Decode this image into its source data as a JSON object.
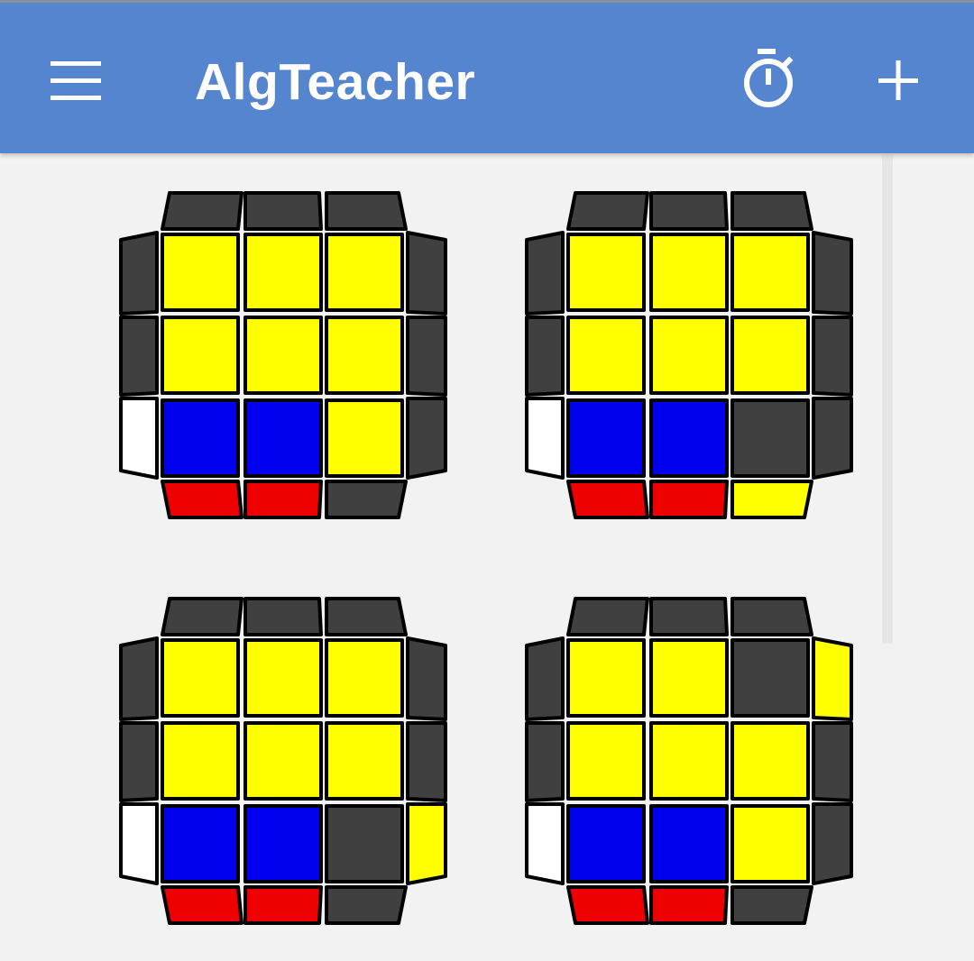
{
  "app": {
    "title": "AlgTeacher",
    "icons": {
      "menu": "hamburger-menu-icon",
      "timer": "stopwatch-icon",
      "add": "plus-icon"
    }
  },
  "colors": {
    "appbar": "#5585cf",
    "background": "#f2f2f2",
    "Y": "#ffff00",
    "B": "#0000ee",
    "R": "#ee0000",
    "W": "#ffffff",
    "G": "#404040"
  },
  "cases": [
    {
      "top": [
        "G",
        "G",
        "G"
      ],
      "left": [
        "G",
        "G",
        "W"
      ],
      "right": [
        "G",
        "G",
        "G"
      ],
      "bottom": [
        "R",
        "R",
        "G"
      ],
      "face": [
        [
          "Y",
          "Y",
          "Y"
        ],
        [
          "Y",
          "Y",
          "Y"
        ],
        [
          "B",
          "B",
          "Y"
        ]
      ]
    },
    {
      "top": [
        "G",
        "G",
        "G"
      ],
      "left": [
        "G",
        "G",
        "W"
      ],
      "right": [
        "G",
        "G",
        "G"
      ],
      "bottom": [
        "R",
        "R",
        "Y"
      ],
      "face": [
        [
          "Y",
          "Y",
          "Y"
        ],
        [
          "Y",
          "Y",
          "Y"
        ],
        [
          "B",
          "B",
          "G"
        ]
      ]
    },
    {
      "top": [
        "G",
        "G",
        "G"
      ],
      "left": [
        "G",
        "G",
        "W"
      ],
      "right": [
        "G",
        "G",
        "Y"
      ],
      "bottom": [
        "R",
        "R",
        "G"
      ],
      "face": [
        [
          "Y",
          "Y",
          "Y"
        ],
        [
          "Y",
          "Y",
          "Y"
        ],
        [
          "B",
          "B",
          "G"
        ]
      ]
    },
    {
      "top": [
        "G",
        "G",
        "G"
      ],
      "left": [
        "G",
        "G",
        "W"
      ],
      "right": [
        "Y",
        "G",
        "G"
      ],
      "bottom": [
        "R",
        "R",
        "G"
      ],
      "face": [
        [
          "Y",
          "Y",
          "G"
        ],
        [
          "Y",
          "Y",
          "Y"
        ],
        [
          "B",
          "B",
          "Y"
        ]
      ]
    }
  ]
}
